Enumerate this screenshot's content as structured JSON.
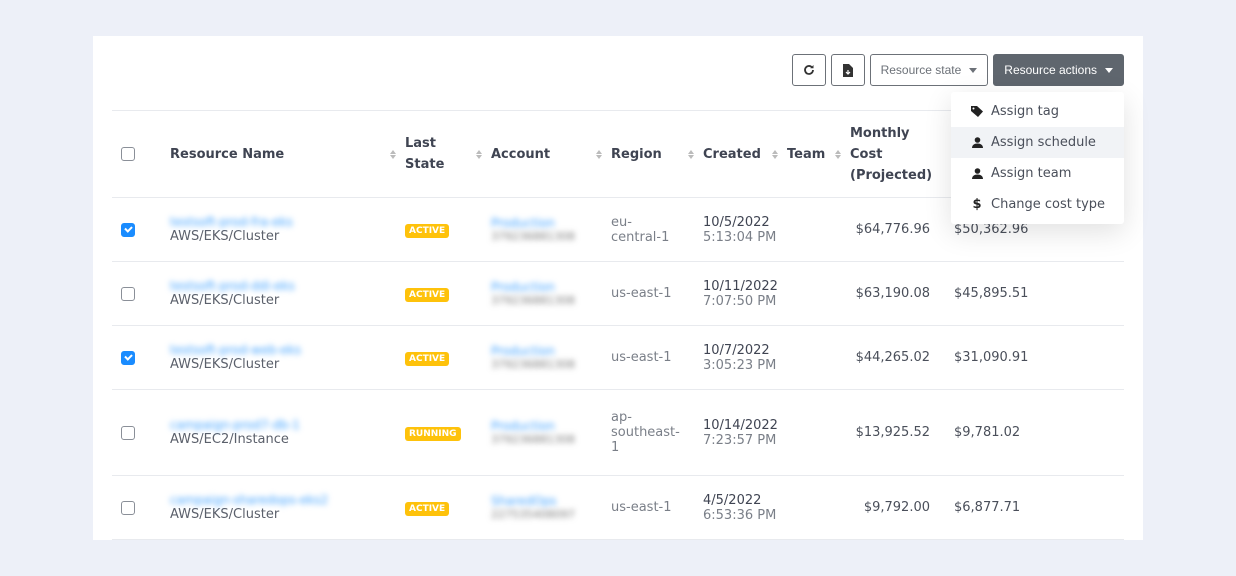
{
  "toolbar": {
    "refresh_icon": "refresh-icon",
    "export_icon": "file-download-icon",
    "resource_state_label": "Resource state",
    "resource_actions_label": "Resource actions"
  },
  "table": {
    "headers": {
      "resource_name": "Resource Name",
      "last_state_line1": "Last",
      "last_state_line2": "State",
      "account": "Account",
      "region": "Region",
      "created": "Created",
      "team": "Team",
      "monthly_cost_line1": "Monthly",
      "monthly_cost_line2": "Cost",
      "monthly_cost_line3": "(Projected)"
    },
    "rows": [
      {
        "checked": true,
        "name": "testsoft-prod-fra-eks",
        "type": "AWS/EKS/Cluster",
        "state": "ACTIVE",
        "account_name": "Production",
        "account_id": "379236881308",
        "region_1": "eu-",
        "region_2": "central-1",
        "region_3": "",
        "date": "10/5/2022",
        "time": "5:13:04 PM",
        "team": "",
        "cost_projected": "$64,776.96",
        "cost_other": "$50,362.96"
      },
      {
        "checked": false,
        "name": "testsoft-prod-ddi-eks",
        "type": "AWS/EKS/Cluster",
        "state": "ACTIVE",
        "account_name": "Production",
        "account_id": "379236881308",
        "region_1": "us-east-1",
        "region_2": "",
        "region_3": "",
        "date": "10/11/2022",
        "time": "7:07:50 PM",
        "team": "",
        "cost_projected": "$63,190.08",
        "cost_other": "$45,895.51"
      },
      {
        "checked": true,
        "name": "testsoft-prod-web-eks",
        "type": "AWS/EKS/Cluster",
        "state": "ACTIVE",
        "account_name": "Production",
        "account_id": "379236881308",
        "region_1": "us-east-1",
        "region_2": "",
        "region_3": "",
        "date": "10/7/2022",
        "time": "3:05:23 PM",
        "team": "",
        "cost_projected": "$44,265.02",
        "cost_other": "$31,090.91"
      },
      {
        "checked": false,
        "name": "campaign-prod7-db-1",
        "type": "AWS/EC2/Instance",
        "state": "RUNNING",
        "account_name": "Production",
        "account_id": "379236881308",
        "region_1": "ap-",
        "region_2": "southeast-",
        "region_3": "1",
        "date": "10/14/2022",
        "time": "7:23:57 PM",
        "team": "",
        "cost_projected": "$13,925.52",
        "cost_other": "$9,781.02"
      },
      {
        "checked": false,
        "name": "campaign-sharedops-eks2",
        "type": "AWS/EKS/Cluster",
        "state": "ACTIVE",
        "account_name": "SharedOps",
        "account_id": "227535408097",
        "region_1": "us-east-1",
        "region_2": "",
        "region_3": "",
        "date": "4/5/2022",
        "time": "6:53:36 PM",
        "team": "",
        "cost_projected": "$9,792.00",
        "cost_other": "$6,877.71"
      }
    ]
  },
  "dropdown": {
    "items": [
      {
        "label": "Assign tag",
        "icon": "tag-icon"
      },
      {
        "label": "Assign schedule",
        "icon": "user-icon"
      },
      {
        "label": "Assign team",
        "icon": "user-icon"
      },
      {
        "label": "Change cost type",
        "icon": "dollar-icon"
      }
    ]
  },
  "colors": {
    "accent": "#1a8cff",
    "badge": "#fec20b",
    "dark_button": "#5f666e",
    "background": "#edf0f8"
  }
}
